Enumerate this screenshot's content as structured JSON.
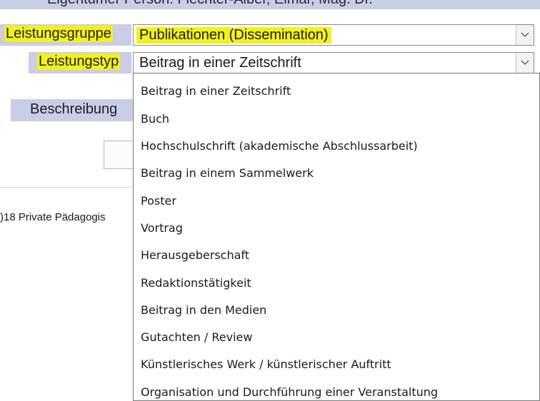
{
  "header": {
    "owner_text": "Eigentümer Person: Flechter-Alber, Elmar, Mag. Dr."
  },
  "form": {
    "leistungsgruppe_label": "Leistungsgruppe",
    "leistungsgruppe_value": "Publikationen (Dissemination)",
    "leistungstyp_label": "Leistungstyp",
    "leistungstyp_value": "Beitrag in einer Zeitschrift",
    "beschreibung_label": "Beschreibung"
  },
  "dropdown": {
    "options": [
      "Beitrag in einer Zeitschrift",
      "Buch",
      "Hochschulschrift (akademische Abschlussarbeit)",
      "Beitrag in einem Sammelwerk",
      "Poster",
      "Vortrag",
      "Herausgeberschaft",
      "Redaktionstätigkeit",
      "Beitrag in den Medien",
      "Gutachten / Review",
      "Künstlerisches Werk / künstlerischer Auftritt",
      "Organisation und Durchführung einer Veranstaltung"
    ]
  },
  "footer": {
    "text": ")18 Private Pädagogis"
  },
  "colors": {
    "band": "#c9cde6",
    "highlight": "#f2f21a"
  }
}
